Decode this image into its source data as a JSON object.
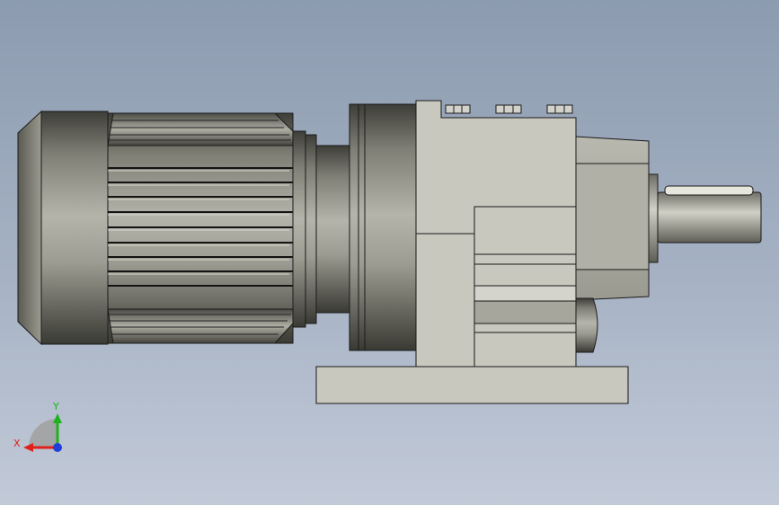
{
  "triad": {
    "x_label": "X",
    "y_label": "Y",
    "x_color": "#e0201b",
    "y_color": "#1db31d",
    "z_color": "#1f3fd8"
  },
  "colors": {
    "background_top": "#8c9bb0",
    "background_bottom": "#c2cad8",
    "motor_metal": "#8a8a80",
    "housing": "#c8c8bf",
    "outline": "#1a1a1a"
  }
}
